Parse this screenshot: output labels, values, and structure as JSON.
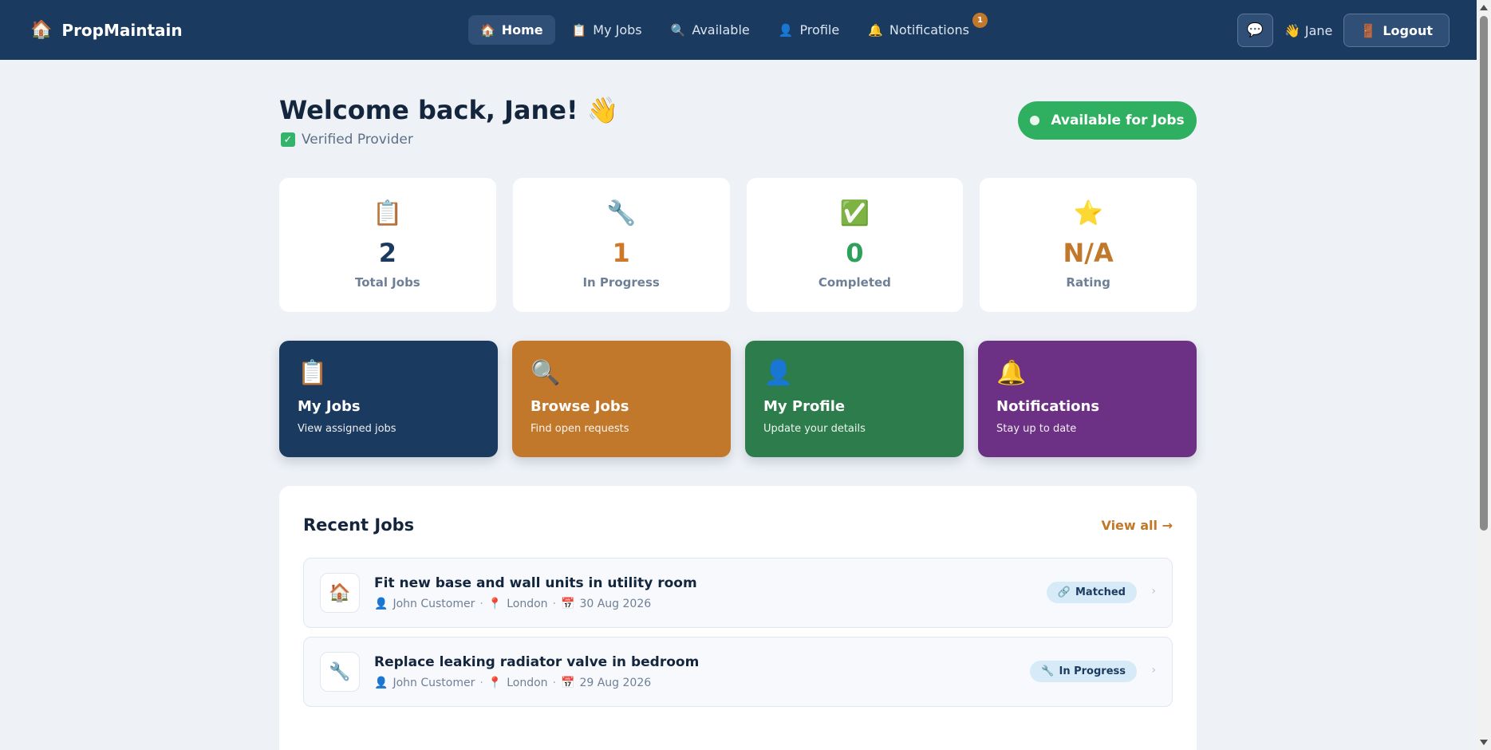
{
  "brand": {
    "icon": "house-icon",
    "name": "PropMaintain"
  },
  "nav": {
    "items": [
      {
        "icon": "house-icon",
        "label": "Home",
        "active": true
      },
      {
        "icon": "clipboard-icon",
        "label": "My Jobs"
      },
      {
        "icon": "magnifier-icon",
        "label": "Available"
      },
      {
        "icon": "person-icon",
        "label": "Profile"
      },
      {
        "icon": "bell-icon",
        "label": "Notifications",
        "badge": "1"
      }
    ],
    "user": "Jane",
    "logout_label": "Logout"
  },
  "welcome": {
    "title": "Welcome back, Jane! 👋",
    "verified_label": "Verified Provider",
    "availability_label": "Available for Jobs"
  },
  "stats": [
    {
      "icon": "clipboard-icon",
      "value": "2",
      "label": "Total Jobs",
      "color": "#1b3a5f"
    },
    {
      "icon": "wrench-icon",
      "value": "1",
      "label": "In Progress",
      "color": "#d0782a"
    },
    {
      "icon": "checkmark-icon",
      "value": "0",
      "label": "Completed",
      "color": "#2ea05a"
    },
    {
      "icon": "star-icon",
      "value": "N/A",
      "label": "Rating",
      "color": "#c2782a"
    }
  ],
  "actions": [
    {
      "icon": "clipboard-icon",
      "title": "My Jobs",
      "subtitle": "View assigned jobs",
      "color": "#1b3a5f"
    },
    {
      "icon": "magnifier-icon",
      "title": "Browse Jobs",
      "subtitle": "Find open requests",
      "color": "#c2782a"
    },
    {
      "icon": "person-icon",
      "title": "My Profile",
      "subtitle": "Update your details",
      "color": "#2c7d4b"
    },
    {
      "icon": "bell-icon",
      "title": "Notifications",
      "subtitle": "Stay up to date",
      "color": "#6c3184"
    }
  ],
  "recent": {
    "title": "Recent Jobs",
    "view_all": "View all →",
    "jobs": [
      {
        "icon": "house-icon",
        "title": "Fit new base and wall units in utility room",
        "customer": "John Customer",
        "location": "London",
        "date": "30 Aug 2026",
        "status": "Matched",
        "status_icon": "link-icon"
      },
      {
        "icon": "wrench-icon",
        "title": "Replace leaking radiator valve in bedroom",
        "customer": "John Customer",
        "location": "London",
        "date": "29 Aug 2026",
        "status": "In Progress",
        "status_icon": "wrench-icon"
      }
    ]
  }
}
